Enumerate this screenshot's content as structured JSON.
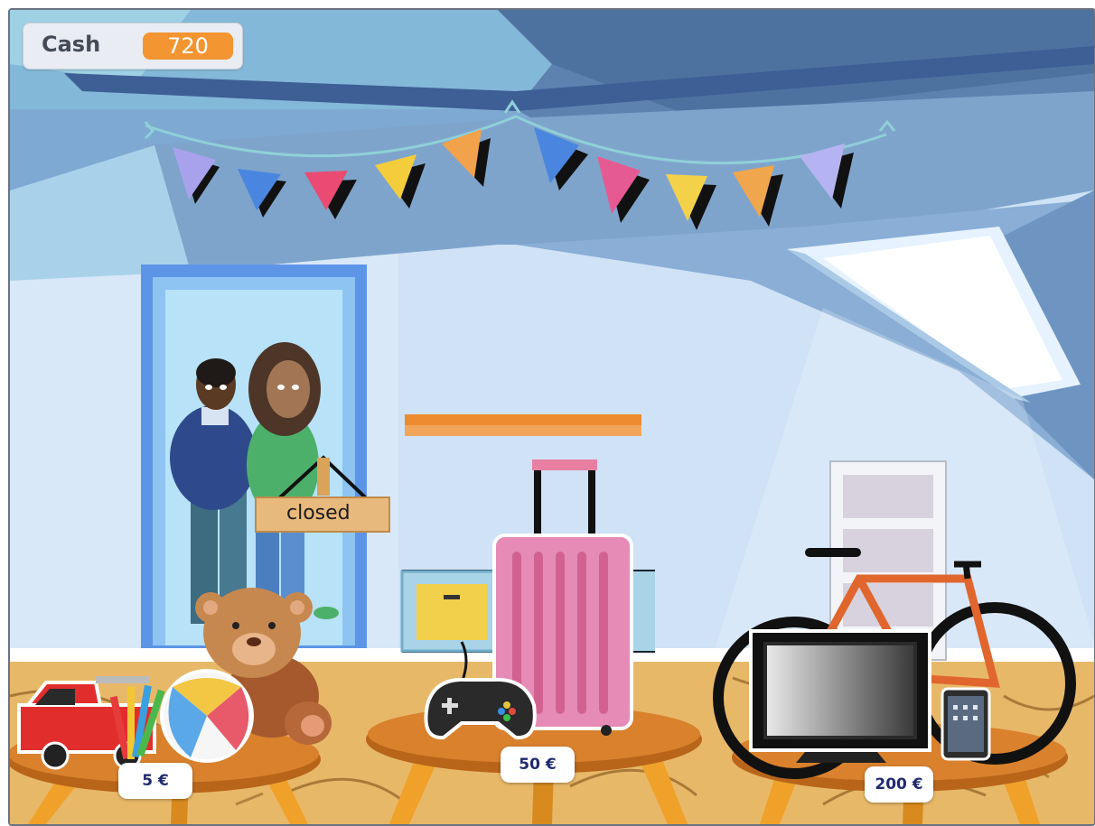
{
  "hud": {
    "cash_label": "Cash",
    "cash_value": "720"
  },
  "door_sign": {
    "text": "closed"
  },
  "tables": [
    {
      "price": "5 €",
      "items": [
        "fire-truck",
        "colored-pencils",
        "beach-ball",
        "teddy-bear"
      ]
    },
    {
      "price": "50 €",
      "items": [
        "game-controller",
        "suitcase"
      ]
    },
    {
      "price": "200 €",
      "items": [
        "television",
        "tablet",
        "bicycle"
      ]
    }
  ],
  "colors": {
    "cash_badge": "#f39531",
    "price_text": "#1f2a6e",
    "wall": "#cfe3f7",
    "ceiling": "#5a7fae",
    "floor": "#e8b869"
  }
}
